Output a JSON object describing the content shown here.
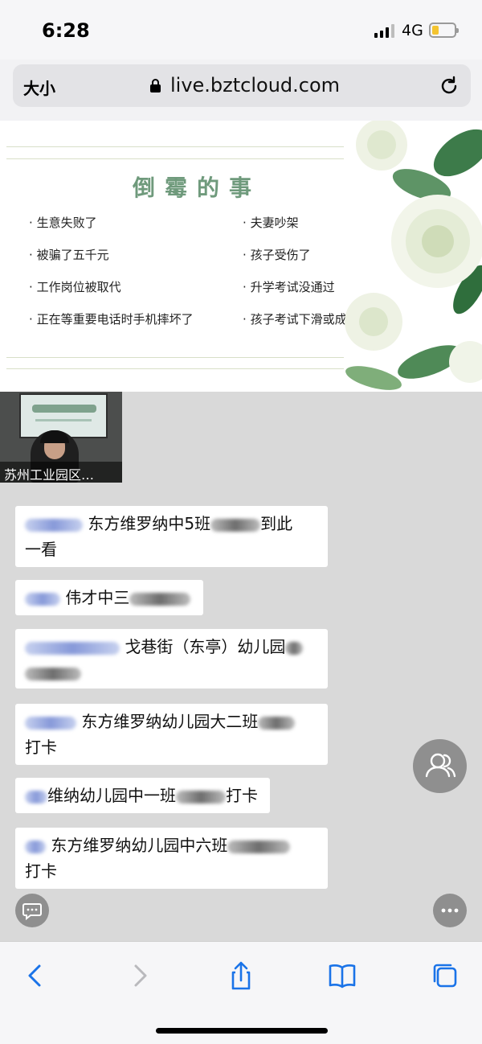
{
  "status_bar": {
    "time": "6:28",
    "network": "4G"
  },
  "address_bar": {
    "text_size_label": "大小",
    "url": "live.bztcloud.com"
  },
  "slide": {
    "title": "倒霉的事",
    "items_left": [
      "生意失败了",
      "被骗了五千元",
      "工作岗位被取代",
      "正在等重要电话时手机摔坏了"
    ],
    "items_right": [
      "夫妻吵架",
      "孩子受伤了",
      "升学考试没通过",
      "孩子考试下滑或成绩不及格"
    ],
    "bullet": "·"
  },
  "video": {
    "label": "苏州工业园区…",
    "board_text": "高上云课堂（一）"
  },
  "chat": {
    "messages": [
      {
        "line1": "东方维罗纳中5班",
        "line1_tail": "到此",
        "line2": "一看"
      },
      {
        "line1": "伟才中三"
      },
      {
        "line1": "戈巷街（东亭）幼儿园"
      },
      {
        "line1": "东方维罗纳幼儿园大二班",
        "line2": "打卡"
      },
      {
        "line1": "维纳幼儿园中一班",
        "line1_tail": "打卡"
      },
      {
        "line1": "东方维罗纳幼儿园中六班",
        "line2": "打卡"
      }
    ]
  },
  "colors": {
    "slide_title": "#6f9a7c",
    "chat_bg": "#d9d9d9",
    "ios_blue": "#1a73e8"
  }
}
